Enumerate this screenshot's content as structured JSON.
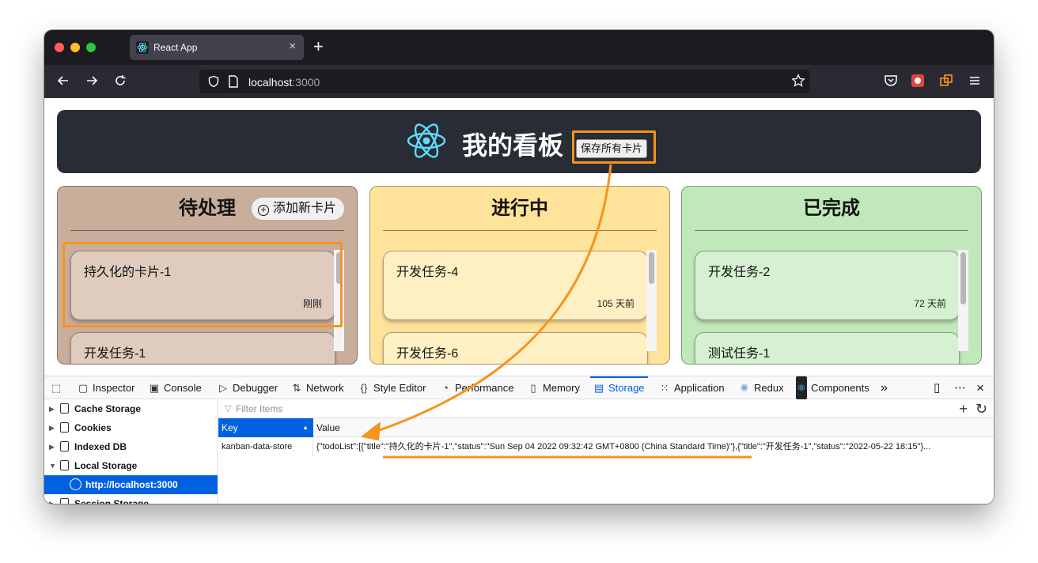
{
  "browser": {
    "tab_title": "React App",
    "url_host": "localhost",
    "url_port": ":3000"
  },
  "app": {
    "title": "我的看板",
    "save_button": "保存所有卡片",
    "columns": [
      {
        "title": "待处理",
        "add_button": "添加新卡片",
        "cards": [
          {
            "title": "持久化的卡片-1",
            "time": "刚刚"
          },
          {
            "title": "开发任务-1",
            "time": ""
          }
        ]
      },
      {
        "title": "进行中",
        "cards": [
          {
            "title": "开发任务-4",
            "time": "105 天前"
          },
          {
            "title": "开发任务-6",
            "time": ""
          }
        ]
      },
      {
        "title": "已完成",
        "cards": [
          {
            "title": "开发任务-2",
            "time": "72 天前"
          },
          {
            "title": "测试任务-1",
            "time": ""
          }
        ]
      }
    ]
  },
  "devtools": {
    "tabs": [
      "Inspector",
      "Console",
      "Debugger",
      "Network",
      "Style Editor",
      "Performance",
      "Memory",
      "Storage",
      "Application",
      "Redux",
      "Components"
    ],
    "active_tab": "Storage",
    "sidebar": [
      "Cache Storage",
      "Cookies",
      "Indexed DB",
      "Local Storage",
      "http://localhost:3000",
      "Session Storage"
    ],
    "filter_placeholder": "Filter Items",
    "columns": {
      "key": "Key",
      "value": "Value"
    },
    "rows": [
      {
        "key": "kanban-data-store",
        "value": "{\"todoList\":[{\"title\":\"持久化的卡片-1\",\"status\":\"Sun Sep 04 2022 09:32:42 GMT+0800 (China Standard Time)\"},{\"title\":\"开发任务-1\",\"status\":\"2022-05-22 18:15\"}..."
      }
    ]
  },
  "colors": {
    "annotation": "#f7931e",
    "todo_column": "#c9ae9c",
    "ongoing_column": "#ffe39a",
    "done_column": "#c0e8ba",
    "header": "#282c34",
    "devtools_accent": "#0061e0"
  }
}
